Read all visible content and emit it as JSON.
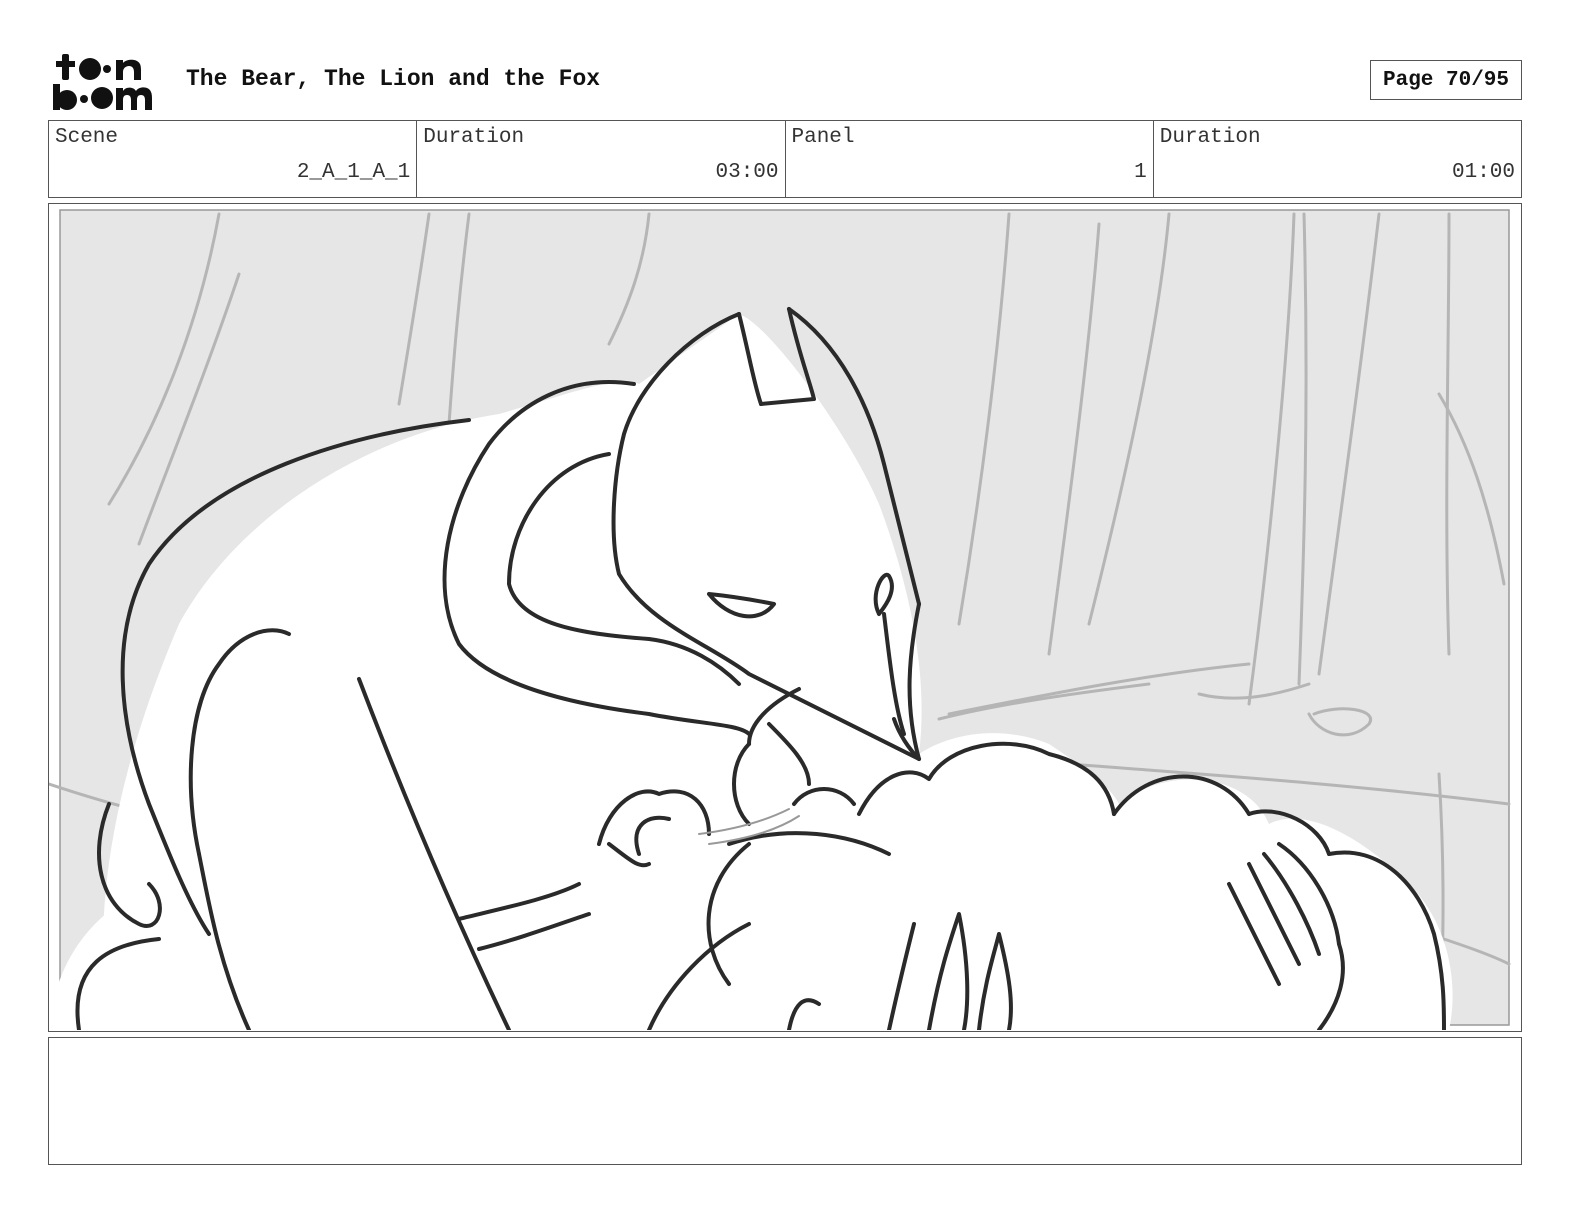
{
  "header": {
    "logo_text": "toon boom",
    "title": "The Bear, The Lion and the Fox",
    "page_label": "Page 70/95"
  },
  "info": {
    "scene_label": "Scene",
    "scene_value": "2_A_1_A_1",
    "scene_duration_label": "Duration",
    "scene_duration_value": "03:00",
    "panel_label": "Panel",
    "panel_value": "1",
    "panel_duration_label": "Duration",
    "panel_duration_value": "01:00"
  },
  "panel": {
    "image_description_icon": "storyboard-sketch-fox-leaning-over-characters",
    "background_color": "#e6e6e6",
    "line_color": "#2a2a2a"
  },
  "notes": {
    "text": ""
  }
}
